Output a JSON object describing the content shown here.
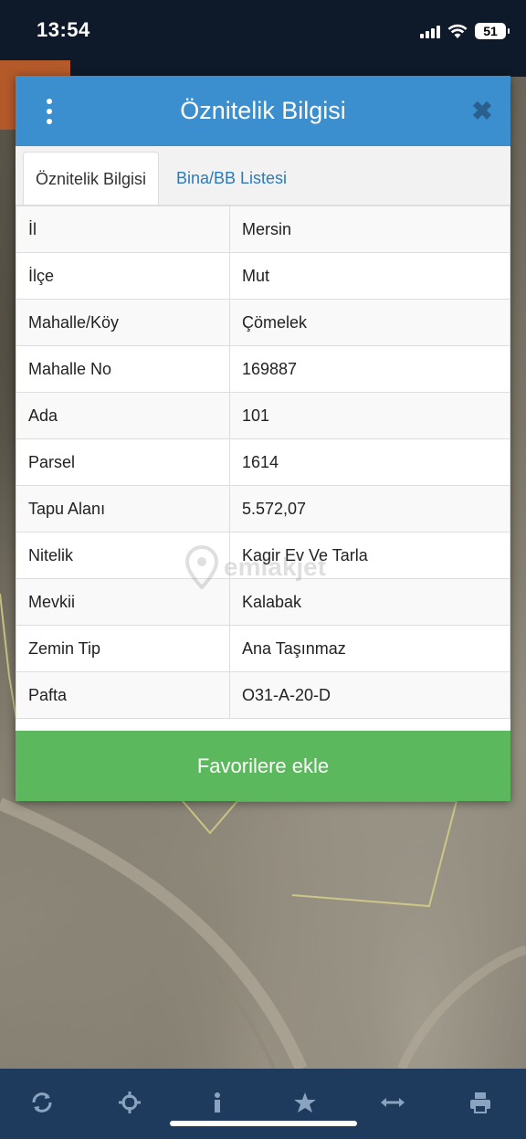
{
  "status_bar": {
    "time": "13:54",
    "battery": "51"
  },
  "modal": {
    "title": "Öznitelik Bilgisi",
    "close_label": "✖",
    "tabs": [
      {
        "label": "Öznitelik Bilgisi",
        "active": true
      },
      {
        "label": "Bina/BB Listesi",
        "active": false
      }
    ],
    "rows": [
      {
        "key": "İl",
        "value": "Mersin"
      },
      {
        "key": "İlçe",
        "value": "Mut"
      },
      {
        "key": "Mahalle/Köy",
        "value": "Çömelek"
      },
      {
        "key": "Mahalle No",
        "value": "169887"
      },
      {
        "key": "Ada",
        "value": "101"
      },
      {
        "key": "Parsel",
        "value": "1614"
      },
      {
        "key": "Tapu Alanı",
        "value": "5.572,07"
      },
      {
        "key": "Nitelik",
        "value": "Kagir Ev Ve Tarla"
      },
      {
        "key": "Mevkii",
        "value": "Kalabak"
      },
      {
        "key": "Zemin Tip",
        "value": "Ana Taşınmaz"
      },
      {
        "key": "Pafta",
        "value": "O31-A-20-D"
      }
    ],
    "watermark": "emlakjet",
    "favorite_button": "Favorilere ekle"
  },
  "bottom_toolbar": {
    "icons": [
      "refresh-icon",
      "crosshair-icon",
      "info-icon",
      "star-icon",
      "measure-icon",
      "print-icon"
    ]
  },
  "colors": {
    "header": "#3c8fcf",
    "favorite": "#5cb85c",
    "toolbar": "#1e3a5c",
    "tab_link": "#2e7ab7"
  }
}
